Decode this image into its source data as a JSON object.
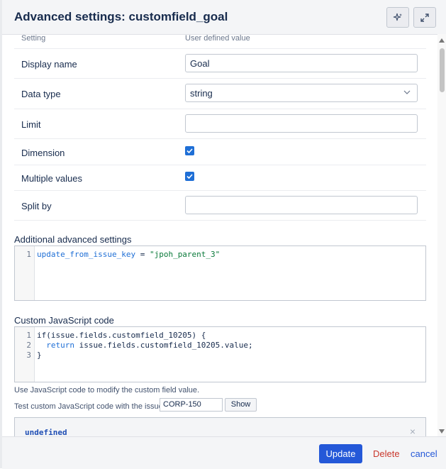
{
  "dialog": {
    "title": "Advanced settings: customfield_goal"
  },
  "table": {
    "col_setting": "Setting",
    "col_value": "User defined value",
    "rows": [
      {
        "label": "Display name",
        "value": "Goal"
      },
      {
        "label": "Data type",
        "value": "string"
      },
      {
        "label": "Limit",
        "value": ""
      },
      {
        "label": "Dimension",
        "checked": true
      },
      {
        "label": "Multiple values",
        "checked": true
      },
      {
        "label": "Split by",
        "value": ""
      }
    ]
  },
  "additional": {
    "label": "Additional advanced settings",
    "line_numbers": [
      "1"
    ],
    "key": "update_from_issue_key",
    "op": " = ",
    "val": "\"jpoh_parent_3\""
  },
  "custom_js": {
    "label": "Custom JavaScript code",
    "line_numbers": [
      "1",
      "2",
      "3"
    ],
    "lines": [
      "if(issue.fields.customfield_10205) {",
      "  return issue.fields.customfield_10205.value;",
      "}"
    ],
    "return_kw": "return",
    "line2_rest": " issue.fields.customfield_10205.value;"
  },
  "help": {
    "note": "Use JavaScript code to modify the custom field value.",
    "test_label": "Test custom JavaScript code with the issue",
    "issue_key": "CORP-150",
    "show_label": "Show",
    "result": "undefined",
    "close": "×"
  },
  "footer": {
    "update_label": "Update",
    "delete_label": "Delete",
    "cancel_label": "cancel"
  },
  "colors": {
    "primary": "#2458d8",
    "danger": "#c9372c",
    "checkbox": "#1f6fd6"
  }
}
